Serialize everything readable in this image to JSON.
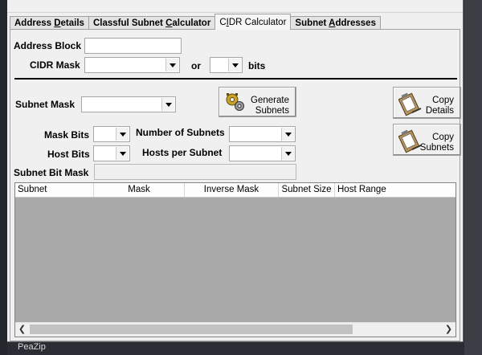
{
  "tabs": [
    {
      "pre": "Address ",
      "u": "D",
      "post": "etails"
    },
    {
      "pre": "Classful Subnet ",
      "u": "C",
      "post": "alculator"
    },
    {
      "pre": "C",
      "u": "I",
      "post": "DR Calculator"
    },
    {
      "pre": "Subnet ",
      "u": "A",
      "post": "ddresses"
    }
  ],
  "form": {
    "address_block_label": "Address Block",
    "address_block_value": "",
    "cidr_mask_label": "CIDR Mask",
    "cidr_mask_value": "",
    "or_label": "or",
    "bits_value": "",
    "bits_label": "bits",
    "subnet_mask_label": "Subnet Mask",
    "subnet_mask_value": "",
    "mask_bits_label": "Mask Bits",
    "mask_bits_value": "",
    "number_of_subnets_label": "Number of Subnets",
    "number_of_subnets_value": "",
    "host_bits_label": "Host Bits",
    "host_bits_value": "",
    "hosts_per_subnet_label": "Hosts per Subnet",
    "hosts_per_subnet_value": "",
    "subnet_bit_mask_label": "Subnet Bit Mask",
    "subnet_bit_mask_value": ""
  },
  "buttons": {
    "generate": {
      "line1": "Generate",
      "line2": "Subnets",
      "icon": "gears-icon"
    },
    "copy_details": {
      "line1": "Copy",
      "line2": "Details",
      "icon": "clipboard-icon"
    },
    "copy_subnets": {
      "line1": "Copy",
      "line2": "Subnets",
      "icon": "clipboard-icon"
    }
  },
  "table": {
    "columns": [
      "Subnet",
      "Mask",
      "Inverse Mask",
      "Subnet Size",
      "Host Range"
    ],
    "rows": []
  },
  "taskbar": {
    "label": "PeaZip"
  },
  "colors": {
    "window_bg": "#f0f0f0",
    "grid_bg": "#a9a9a9",
    "desktop": "#2a2d33"
  }
}
